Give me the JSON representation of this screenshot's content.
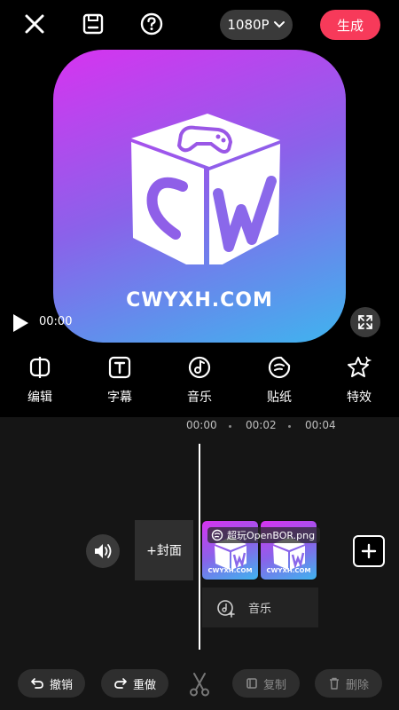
{
  "topbar": {
    "resolution_label": "1080P",
    "generate_label": "生成"
  },
  "preview": {
    "logo_text": "CWYXH.COM",
    "current_time": "00:00"
  },
  "tools": [
    {
      "label": "编辑",
      "icon": "edit-split-icon"
    },
    {
      "label": "字幕",
      "icon": "text-icon"
    },
    {
      "label": "音乐",
      "icon": "music-icon"
    },
    {
      "label": "贴纸",
      "icon": "sticker-icon"
    },
    {
      "label": "特效",
      "icon": "effects-star-icon"
    }
  ],
  "timeline": {
    "ruler": [
      "00:00",
      "00:02",
      "00:04"
    ],
    "cover_label": "+封面",
    "clip_mini_text": "CWYXH.COM",
    "sticker_label": "超玩OpenBOR.png",
    "music_label": "音乐"
  },
  "actions": {
    "undo_label": "撤销",
    "redo_label": "重做",
    "copy_label": "复制",
    "delete_label": "删除"
  },
  "colors": {
    "accent": "#f73a5a",
    "gradient_start": "#d733f0",
    "gradient_end": "#3fb4ee"
  }
}
